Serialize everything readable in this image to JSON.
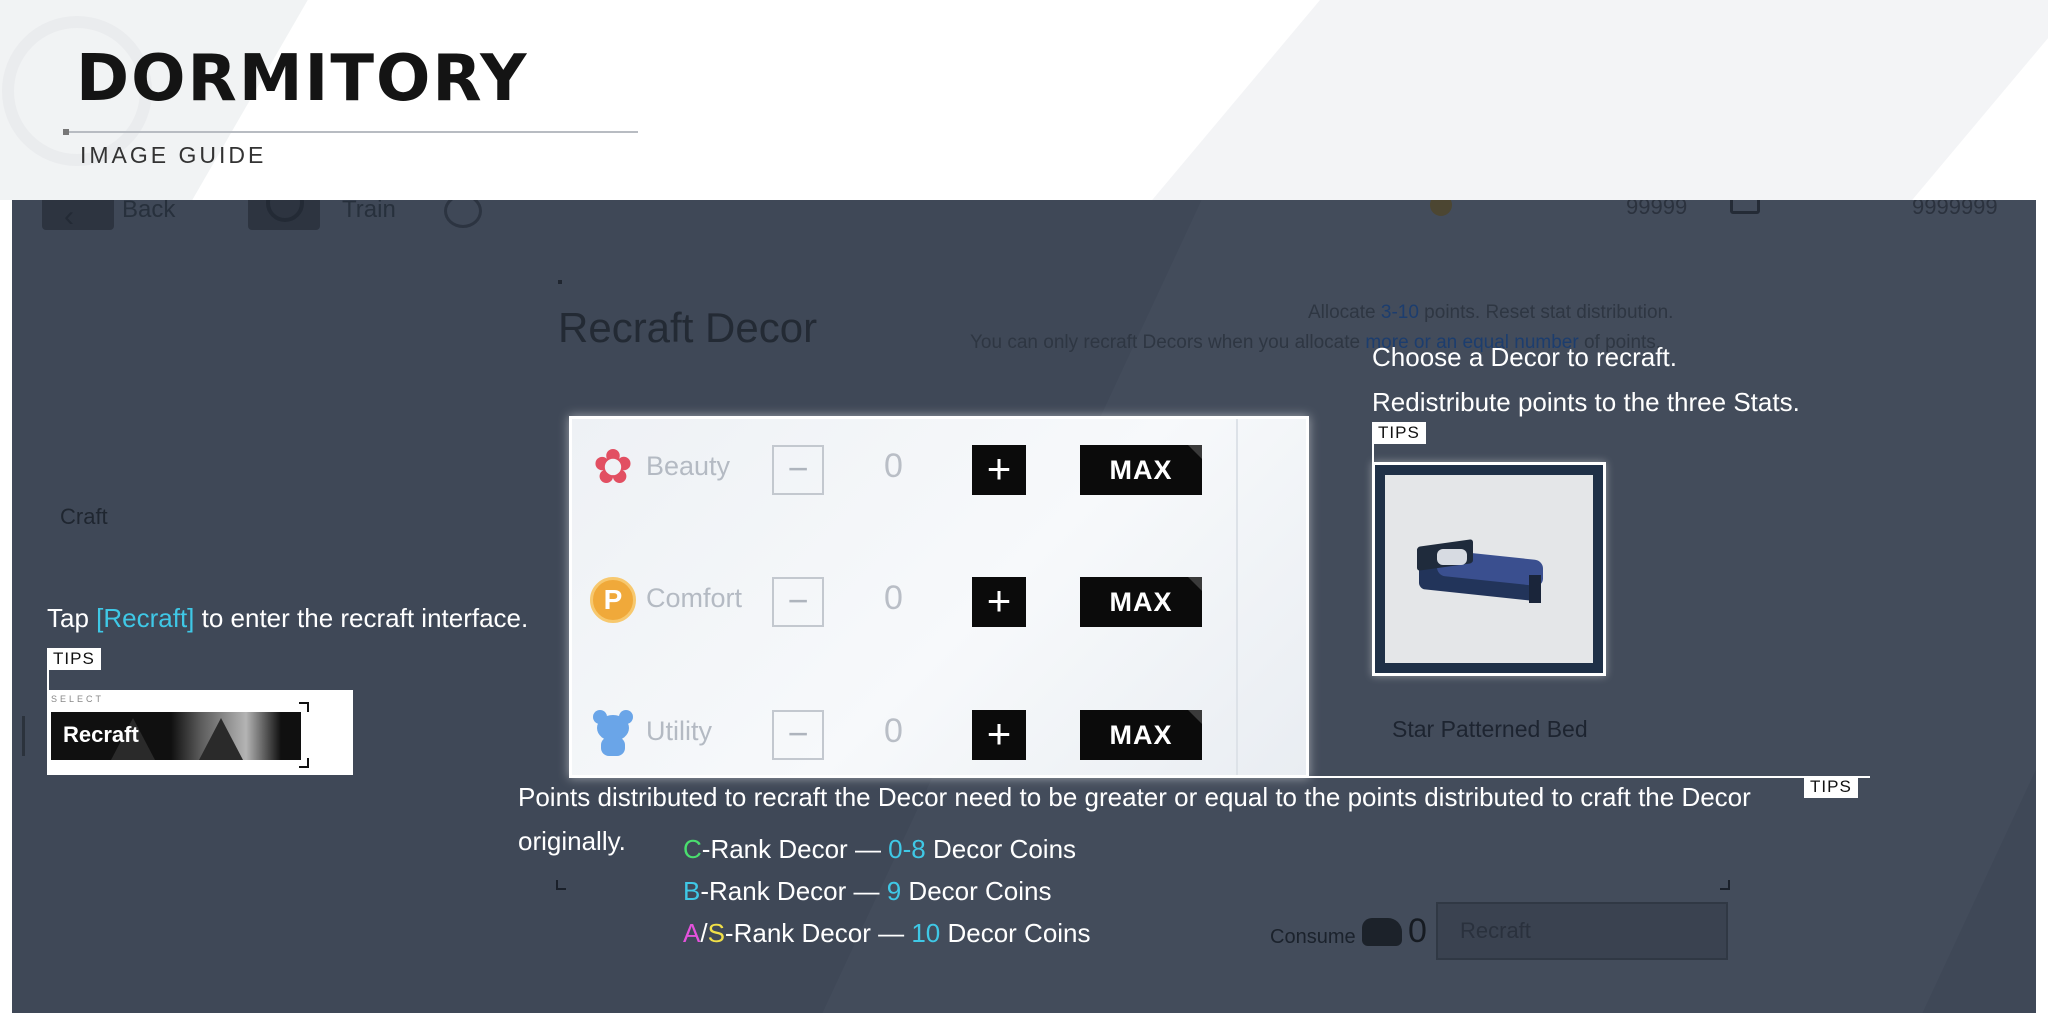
{
  "header": {
    "title": "DORMITORY",
    "subtitle": "IMAGE GUIDE"
  },
  "game": {
    "back_label": "Back",
    "train_label": "Train",
    "gold_value": "99999",
    "gem_value": "9999999",
    "craft_label": "Craft",
    "recraft_heading": "Recraft Decor",
    "alloc_note_prefix": "Allocate ",
    "alloc_note_range": "3-10",
    "alloc_note_suffix": " points. Reset stat distribution.",
    "alloc_note_line2_a": "You can only recraft Decors when you allocate ",
    "alloc_note_line2_b": "more or an equal number",
    "alloc_note_line2_c": " of points.",
    "item_name": "Star Patterned Bed",
    "consume_label": "Consume",
    "consume_value": "0",
    "recraft_button_label": "Recraft"
  },
  "stats": [
    {
      "name": "Beauty",
      "icon": "beauty-flower-icon",
      "value": "0",
      "minus": "−",
      "plus": "+",
      "max": "MAX"
    },
    {
      "name": "Comfort",
      "icon": "comfort-coin-icon",
      "icon_letter": "P",
      "value": "0",
      "minus": "−",
      "plus": "+",
      "max": "MAX"
    },
    {
      "name": "Utility",
      "icon": "utility-bear-icon",
      "value": "0",
      "minus": "−",
      "plus": "+",
      "max": "MAX"
    }
  ],
  "highlight_recraft": {
    "select_text": "SELECT",
    "label": "Recraft"
  },
  "tips": {
    "tag": "TIPS",
    "tip1": {
      "prefix": "Tap ",
      "highlight": "[Recraft]",
      "suffix": " to enter the recraft interface."
    },
    "tip2": {
      "line1": "Choose a Decor to recraft.",
      "line2": "Redistribute points to the three Stats."
    },
    "tip3": {
      "line1": "Points distributed to recraft the Decor need to be greater or equal to the points distributed to craft the Decor",
      "line2": "originally.",
      "ranks": [
        {
          "rank": "C",
          "text": "-Rank Decor — ",
          "coins": "0-8",
          "unit": " Decor Coins"
        },
        {
          "rank": "B",
          "text": "-Rank Decor — ",
          "coins": "9",
          "unit": " Decor Coins"
        },
        {
          "rank_a": "A",
          "slash": "/",
          "rank_s": "S",
          "text": "-Rank Decor — ",
          "coins": "10",
          "unit": " Decor Coins"
        }
      ]
    }
  },
  "colors": {
    "accent_cyan": "#3fc8e6",
    "rank_c": "#4ade6e",
    "rank_a": "#e552dc",
    "rank_s": "#f1e048",
    "overlay": "#3f4857"
  }
}
